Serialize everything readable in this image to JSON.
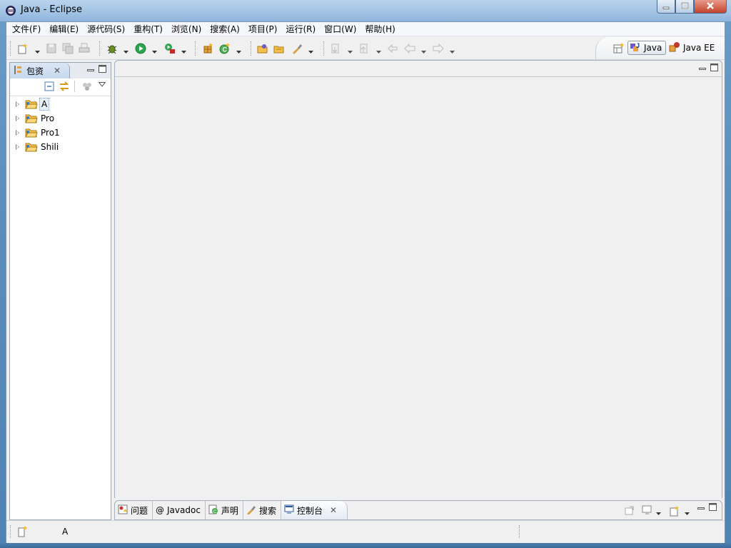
{
  "window": {
    "title": "Java  -  Eclipse",
    "controls": {
      "minimize_icon": "minimize-icon",
      "maximize_icon": "maximize-icon",
      "close_icon": "close-icon"
    }
  },
  "menubar": {
    "items": [
      "文件(F)",
      "编辑(E)",
      "源代码(S)",
      "重构(T)",
      "浏览(N)",
      "搜索(A)",
      "项目(P)",
      "运行(R)",
      "窗口(W)",
      "帮助(H)"
    ]
  },
  "toolbar": {
    "icons": [
      "new-wizard-icon",
      "save-icon",
      "save-all-icon",
      "print-icon",
      "debug-icon",
      "run-icon",
      "external-tools-icon",
      "new-java-package-icon",
      "new-java-class-icon",
      "open-type-icon",
      "open-task-icon",
      "search-icon",
      "next-annotation-icon",
      "previous-annotation-icon",
      "last-edit-location-icon",
      "back-icon",
      "forward-icon"
    ]
  },
  "perspectives": {
    "open_icon": "open-perspective-icon",
    "items": [
      {
        "label": "Java",
        "active": true
      },
      {
        "label": "Java EE",
        "active": false
      }
    ]
  },
  "package_explorer": {
    "tab_label": "包资",
    "projects": [
      {
        "label": "A",
        "selected": true
      },
      {
        "label": "Pro",
        "selected": false
      },
      {
        "label": "Pro1",
        "selected": false
      },
      {
        "label": "Shili",
        "selected": false
      }
    ]
  },
  "bottom_panel": {
    "tabs": [
      {
        "label": "问题",
        "icon": "problems-icon",
        "active": false
      },
      {
        "label": "Javadoc",
        "icon": "javadoc-icon",
        "active": false
      },
      {
        "label": "声明",
        "icon": "declaration-icon",
        "active": false
      },
      {
        "label": "搜索",
        "icon": "search-icon",
        "active": false
      },
      {
        "label": "控制台",
        "icon": "console-icon",
        "active": true
      }
    ]
  },
  "statusbar": {
    "text": "A"
  },
  "colors": {
    "title_bar": "#a6c6e6",
    "selection_bg": "#e8f1fb",
    "background": "#f0f0f0"
  }
}
